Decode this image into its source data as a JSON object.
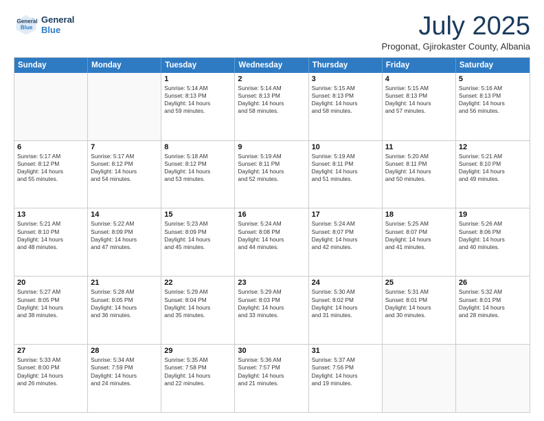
{
  "header": {
    "logo_line1": "General",
    "logo_line2": "Blue",
    "month": "July 2025",
    "location": "Progonat, Gjirokaster County, Albania"
  },
  "weekdays": [
    "Sunday",
    "Monday",
    "Tuesday",
    "Wednesday",
    "Thursday",
    "Friday",
    "Saturday"
  ],
  "weeks": [
    [
      {
        "day": "",
        "lines": [],
        "empty": true
      },
      {
        "day": "",
        "lines": [],
        "empty": true
      },
      {
        "day": "1",
        "lines": [
          "Sunrise: 5:14 AM",
          "Sunset: 8:13 PM",
          "Daylight: 14 hours",
          "and 59 minutes."
        ],
        "empty": false
      },
      {
        "day": "2",
        "lines": [
          "Sunrise: 5:14 AM",
          "Sunset: 8:13 PM",
          "Daylight: 14 hours",
          "and 58 minutes."
        ],
        "empty": false
      },
      {
        "day": "3",
        "lines": [
          "Sunrise: 5:15 AM",
          "Sunset: 8:13 PM",
          "Daylight: 14 hours",
          "and 58 minutes."
        ],
        "empty": false
      },
      {
        "day": "4",
        "lines": [
          "Sunrise: 5:15 AM",
          "Sunset: 8:13 PM",
          "Daylight: 14 hours",
          "and 57 minutes."
        ],
        "empty": false
      },
      {
        "day": "5",
        "lines": [
          "Sunrise: 5:16 AM",
          "Sunset: 8:13 PM",
          "Daylight: 14 hours",
          "and 56 minutes."
        ],
        "empty": false
      }
    ],
    [
      {
        "day": "6",
        "lines": [
          "Sunrise: 5:17 AM",
          "Sunset: 8:12 PM",
          "Daylight: 14 hours",
          "and 55 minutes."
        ],
        "empty": false
      },
      {
        "day": "7",
        "lines": [
          "Sunrise: 5:17 AM",
          "Sunset: 8:12 PM",
          "Daylight: 14 hours",
          "and 54 minutes."
        ],
        "empty": false
      },
      {
        "day": "8",
        "lines": [
          "Sunrise: 5:18 AM",
          "Sunset: 8:12 PM",
          "Daylight: 14 hours",
          "and 53 minutes."
        ],
        "empty": false
      },
      {
        "day": "9",
        "lines": [
          "Sunrise: 5:19 AM",
          "Sunset: 8:11 PM",
          "Daylight: 14 hours",
          "and 52 minutes."
        ],
        "empty": false
      },
      {
        "day": "10",
        "lines": [
          "Sunrise: 5:19 AM",
          "Sunset: 8:11 PM",
          "Daylight: 14 hours",
          "and 51 minutes."
        ],
        "empty": false
      },
      {
        "day": "11",
        "lines": [
          "Sunrise: 5:20 AM",
          "Sunset: 8:11 PM",
          "Daylight: 14 hours",
          "and 50 minutes."
        ],
        "empty": false
      },
      {
        "day": "12",
        "lines": [
          "Sunrise: 5:21 AM",
          "Sunset: 8:10 PM",
          "Daylight: 14 hours",
          "and 49 minutes."
        ],
        "empty": false
      }
    ],
    [
      {
        "day": "13",
        "lines": [
          "Sunrise: 5:21 AM",
          "Sunset: 8:10 PM",
          "Daylight: 14 hours",
          "and 48 minutes."
        ],
        "empty": false
      },
      {
        "day": "14",
        "lines": [
          "Sunrise: 5:22 AM",
          "Sunset: 8:09 PM",
          "Daylight: 14 hours",
          "and 47 minutes."
        ],
        "empty": false
      },
      {
        "day": "15",
        "lines": [
          "Sunrise: 5:23 AM",
          "Sunset: 8:09 PM",
          "Daylight: 14 hours",
          "and 45 minutes."
        ],
        "empty": false
      },
      {
        "day": "16",
        "lines": [
          "Sunrise: 5:24 AM",
          "Sunset: 8:08 PM",
          "Daylight: 14 hours",
          "and 44 minutes."
        ],
        "empty": false
      },
      {
        "day": "17",
        "lines": [
          "Sunrise: 5:24 AM",
          "Sunset: 8:07 PM",
          "Daylight: 14 hours",
          "and 42 minutes."
        ],
        "empty": false
      },
      {
        "day": "18",
        "lines": [
          "Sunrise: 5:25 AM",
          "Sunset: 8:07 PM",
          "Daylight: 14 hours",
          "and 41 minutes."
        ],
        "empty": false
      },
      {
        "day": "19",
        "lines": [
          "Sunrise: 5:26 AM",
          "Sunset: 8:06 PM",
          "Daylight: 14 hours",
          "and 40 minutes."
        ],
        "empty": false
      }
    ],
    [
      {
        "day": "20",
        "lines": [
          "Sunrise: 5:27 AM",
          "Sunset: 8:05 PM",
          "Daylight: 14 hours",
          "and 38 minutes."
        ],
        "empty": false
      },
      {
        "day": "21",
        "lines": [
          "Sunrise: 5:28 AM",
          "Sunset: 8:05 PM",
          "Daylight: 14 hours",
          "and 36 minutes."
        ],
        "empty": false
      },
      {
        "day": "22",
        "lines": [
          "Sunrise: 5:29 AM",
          "Sunset: 8:04 PM",
          "Daylight: 14 hours",
          "and 35 minutes."
        ],
        "empty": false
      },
      {
        "day": "23",
        "lines": [
          "Sunrise: 5:29 AM",
          "Sunset: 8:03 PM",
          "Daylight: 14 hours",
          "and 33 minutes."
        ],
        "empty": false
      },
      {
        "day": "24",
        "lines": [
          "Sunrise: 5:30 AM",
          "Sunset: 8:02 PM",
          "Daylight: 14 hours",
          "and 31 minutes."
        ],
        "empty": false
      },
      {
        "day": "25",
        "lines": [
          "Sunrise: 5:31 AM",
          "Sunset: 8:01 PM",
          "Daylight: 14 hours",
          "and 30 minutes."
        ],
        "empty": false
      },
      {
        "day": "26",
        "lines": [
          "Sunrise: 5:32 AM",
          "Sunset: 8:01 PM",
          "Daylight: 14 hours",
          "and 28 minutes."
        ],
        "empty": false
      }
    ],
    [
      {
        "day": "27",
        "lines": [
          "Sunrise: 5:33 AM",
          "Sunset: 8:00 PM",
          "Daylight: 14 hours",
          "and 26 minutes."
        ],
        "empty": false
      },
      {
        "day": "28",
        "lines": [
          "Sunrise: 5:34 AM",
          "Sunset: 7:59 PM",
          "Daylight: 14 hours",
          "and 24 minutes."
        ],
        "empty": false
      },
      {
        "day": "29",
        "lines": [
          "Sunrise: 5:35 AM",
          "Sunset: 7:58 PM",
          "Daylight: 14 hours",
          "and 22 minutes."
        ],
        "empty": false
      },
      {
        "day": "30",
        "lines": [
          "Sunrise: 5:36 AM",
          "Sunset: 7:57 PM",
          "Daylight: 14 hours",
          "and 21 minutes."
        ],
        "empty": false
      },
      {
        "day": "31",
        "lines": [
          "Sunrise: 5:37 AM",
          "Sunset: 7:56 PM",
          "Daylight: 14 hours",
          "and 19 minutes."
        ],
        "empty": false
      },
      {
        "day": "",
        "lines": [],
        "empty": true
      },
      {
        "day": "",
        "lines": [],
        "empty": true
      }
    ]
  ]
}
